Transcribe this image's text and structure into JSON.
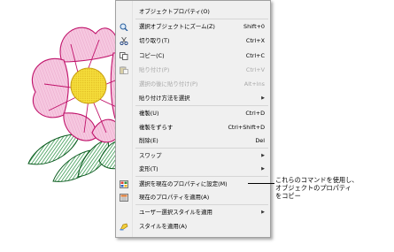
{
  "context_menu": {
    "items": [
      {
        "label": "オブジェクトプロパティ(O)",
        "shortcut": "",
        "icon": "",
        "submenu": false,
        "disabled": false
      },
      {
        "label": "選択オブジェクトにズーム(Z)",
        "shortcut": "Shift+0",
        "icon": "zoom-icon",
        "submenu": false,
        "disabled": false
      },
      {
        "label": "切り取り(T)",
        "shortcut": "Ctrl+X",
        "icon": "scissors-icon",
        "submenu": false,
        "disabled": false
      },
      {
        "label": "コピー(C)",
        "shortcut": "Ctrl+C",
        "icon": "copy-icon",
        "submenu": false,
        "disabled": false
      },
      {
        "label": "貼り付け(P)",
        "shortcut": "Ctrl+V",
        "icon": "paste-icon",
        "submenu": false,
        "disabled": true
      },
      {
        "label": "選択の後に貼り付け(P)",
        "shortcut": "Alt+Ins",
        "icon": "",
        "submenu": false,
        "disabled": true
      },
      {
        "label": "貼り付け方法を選択",
        "shortcut": "",
        "icon": "",
        "submenu": true,
        "disabled": false
      },
      {
        "label": "複製(U)",
        "shortcut": "Ctrl+D",
        "icon": "",
        "submenu": false,
        "disabled": false
      },
      {
        "label": "複製をずらす",
        "shortcut": "Ctrl+Shift+D",
        "icon": "",
        "submenu": false,
        "disabled": false
      },
      {
        "label": "削除(E)",
        "shortcut": "Del",
        "icon": "",
        "submenu": false,
        "disabled": false
      },
      {
        "label": "スワップ",
        "shortcut": "",
        "icon": "",
        "submenu": true,
        "disabled": false
      },
      {
        "label": "変形(T)",
        "shortcut": "",
        "icon": "",
        "submenu": true,
        "disabled": false
      },
      {
        "label": "選択を現在のプロパティに設定(M)",
        "shortcut": "",
        "icon": "set-properties-icon",
        "submenu": false,
        "disabled": false
      },
      {
        "label": "現在のプロパティを適用(A)",
        "shortcut": "",
        "icon": "apply-properties-icon",
        "submenu": false,
        "disabled": false
      },
      {
        "label": "ユーザー選択スタイルを適用",
        "shortcut": "",
        "icon": "",
        "submenu": true,
        "disabled": false
      },
      {
        "label": "スタイルを適用(A)",
        "shortcut": "",
        "icon": "style-icon",
        "submenu": false,
        "disabled": false
      }
    ]
  },
  "callout": {
    "line1": "これらのコマンドを使用し、",
    "line2": "オブジェクトのプロパティ",
    "line3": "をコピー"
  },
  "colors": {
    "petal": "#f4b6d6",
    "petal_stitch": "#c0126a",
    "center": "#f7e14a",
    "leaf": "#2ea84a",
    "leaf_stitch": "#0a5a1e"
  }
}
